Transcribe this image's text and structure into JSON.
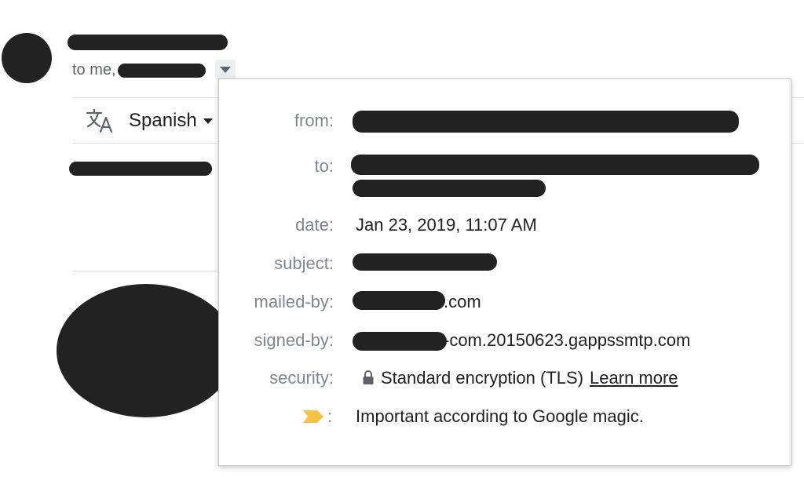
{
  "header": {
    "to_prefix": "to me,"
  },
  "translate": {
    "language": "Spanish"
  },
  "details": {
    "labels": {
      "from": "from:",
      "to": "to:",
      "date": "date:",
      "subject": "subject:",
      "mailed_by": "mailed-by:",
      "signed_by": "signed-by:",
      "security": "security:",
      "importance_suffix": ":"
    },
    "date": "Jan 23, 2019, 11:07 AM",
    "mailed_by_suffix": ".com",
    "signed_by_suffix": "-com.20150623.gappssmtp.com",
    "security_text": "Standard encryption (TLS)",
    "learn_more": "Learn more",
    "importance_text": "Important according to Google magic."
  },
  "icons": {
    "translate": "translate-icon",
    "lock": "lock-icon",
    "importance": "importance-marker-icon",
    "dropdown": "chevron-down-icon"
  },
  "colors": {
    "importance_marker": "#F5C242",
    "redaction": "#222222",
    "label_gray": "#80868b"
  }
}
